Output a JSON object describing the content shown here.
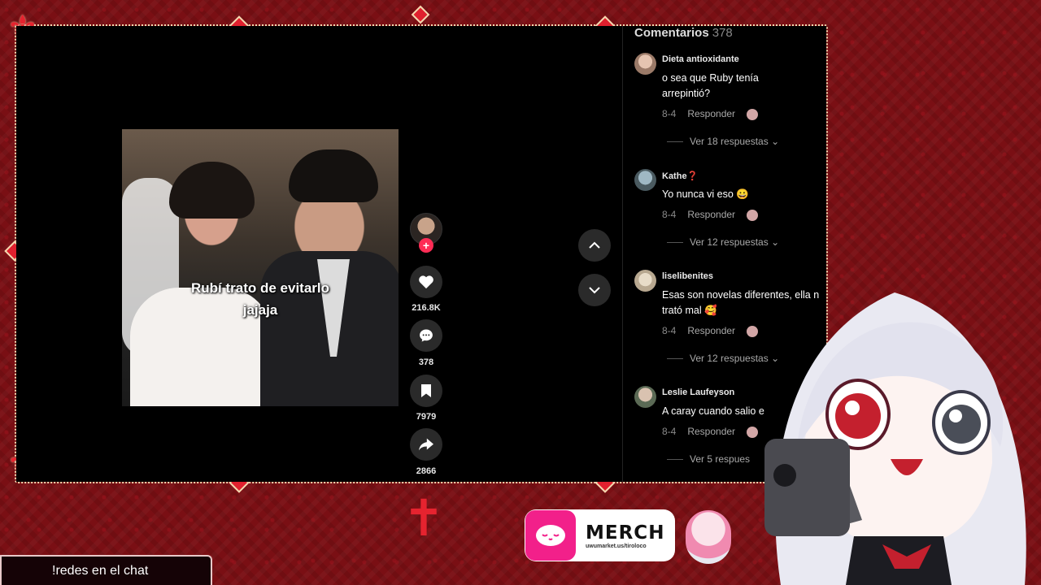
{
  "video": {
    "caption_line1": "Rubí trato de evitarlo",
    "caption_line2": "jajaja"
  },
  "actions": {
    "likes": "216.8K",
    "comments": "378",
    "saves": "7979",
    "shares": "2866"
  },
  "comments_panel": {
    "title": "Comentarios",
    "count": "378",
    "items": [
      {
        "user": "Dieta antioxidante",
        "text": "o sea que Ruby tenía... arrepintió?",
        "text_line1": "o sea que Ruby tenía",
        "text_line2": "arrepintió?",
        "date": "8-4",
        "reply": "Responder",
        "more": "Ver 18 respuestas"
      },
      {
        "user": "Kathe❓",
        "text": "Yo nunca vi eso 😀",
        "date": "8-4",
        "reply": "Responder",
        "more": "Ver 12 respuestas"
      },
      {
        "user": "liselibenites",
        "text_line1": "Esas son novelas diferentes, ella n",
        "text_line2": "trató mal 🥰",
        "date": "8-4",
        "reply": "Responder",
        "more": "Ver 12 respuestas"
      },
      {
        "user": "Leslie Laufeyson",
        "text": "A caray cuando salio e",
        "date": "8-4",
        "reply": "Responder",
        "more": "Ver 5 respues"
      }
    ]
  },
  "merch": {
    "title": "MERCH",
    "url": "uwumarket.us/tiroloco"
  },
  "chat_bar": {
    "text": "!redes en el chat"
  },
  "colors": {
    "frame_red": "#7a0f14",
    "accent_red": "#e0202e",
    "gold": "#f3d9b0",
    "tiktok_pink": "#fe2c55",
    "merch_pink": "#f2208a"
  }
}
